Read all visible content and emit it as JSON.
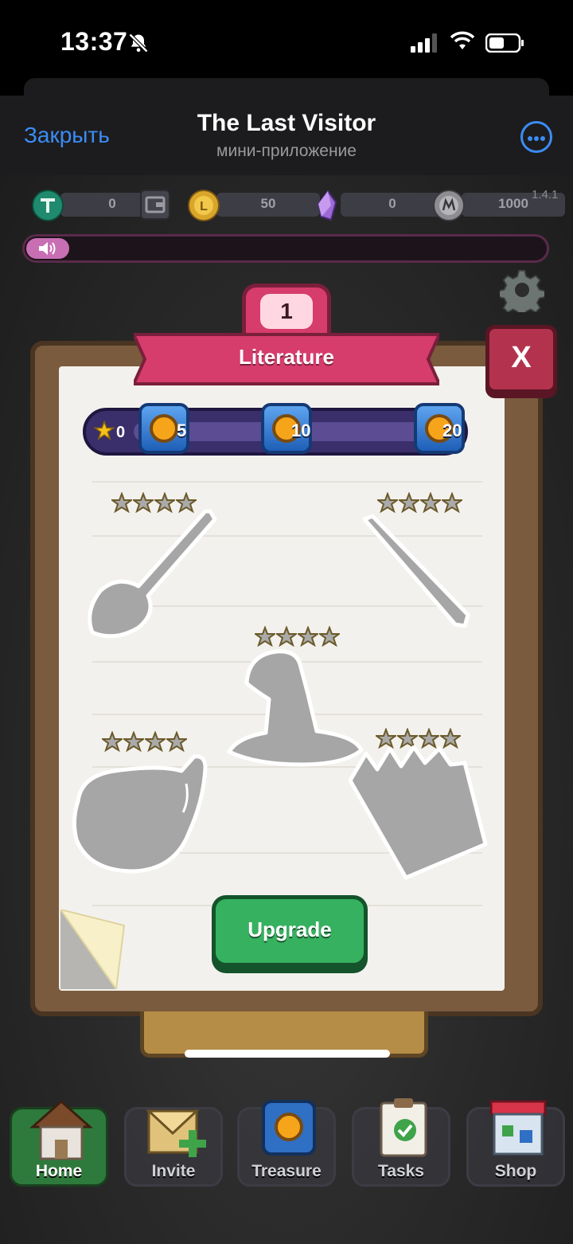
{
  "status_bar": {
    "time": "13:37"
  },
  "header": {
    "close_label": "Закрыть",
    "title": "The Last Visitor",
    "subtitle": "мини-приложение"
  },
  "resources": [
    {
      "icon": "tether-coin-icon",
      "value": "0"
    },
    {
      "icon": "gold-coin-icon",
      "value": "50"
    },
    {
      "icon": "crystal-icon",
      "value": "0"
    },
    {
      "icon": "silver-coin-icon",
      "value": "1000"
    }
  ],
  "version": "1.4.1",
  "panel": {
    "level": "1",
    "title": "Literature",
    "close_label": "X",
    "stars": "0",
    "milestones": [
      "5",
      "10",
      "20"
    ],
    "upgrade_label": "Upgrade",
    "items": [
      {
        "name": "broom",
        "stars": 4
      },
      {
        "name": "wand",
        "stars": 4
      },
      {
        "name": "wizard-hat",
        "stars": 4
      },
      {
        "name": "cauldron",
        "stars": 4
      },
      {
        "name": "spell-book",
        "stars": 4
      }
    ]
  },
  "nav": [
    {
      "label": "Home",
      "icon": "house-icon",
      "active": true
    },
    {
      "label": "Invite",
      "icon": "envelope-icon",
      "active": false
    },
    {
      "label": "Treasure",
      "icon": "safe-icon",
      "active": false
    },
    {
      "label": "Tasks",
      "icon": "clipboard-icon",
      "active": false
    },
    {
      "label": "Shop",
      "icon": "shop-icon",
      "active": false
    }
  ],
  "colors": {
    "accent_blue": "#3b8cf5",
    "panel_pink": "#d63c6c",
    "upgrade_green": "#36b15f"
  }
}
